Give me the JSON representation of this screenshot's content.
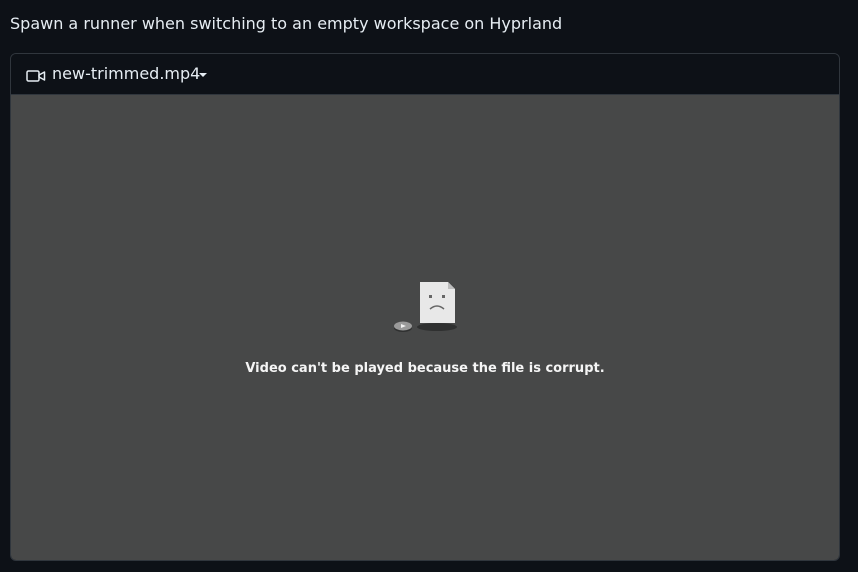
{
  "page": {
    "title": "Spawn a runner when switching to an empty workspace on Hyprland"
  },
  "attachment": {
    "icon": "video-camera-icon",
    "file_name": "new-trimmed.mp4",
    "dropdown_icon": "caret-down-icon"
  },
  "player": {
    "illustration_icon": "corrupt-file-icon",
    "error_message": "Video can't be played because the file is corrupt."
  },
  "colors": {
    "page_background": "#0d1117",
    "player_background": "#474848",
    "text": "#e6edf3"
  }
}
